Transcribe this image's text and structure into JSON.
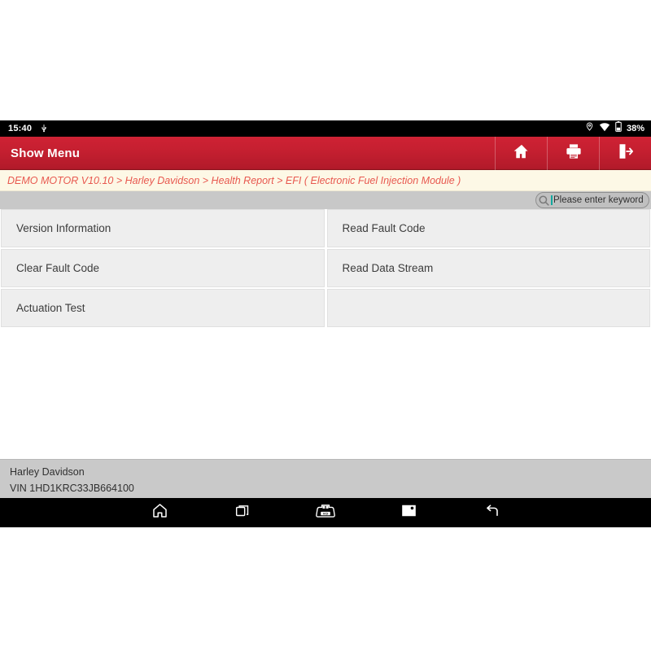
{
  "statusbar": {
    "time": "15:40",
    "usb_icon": "usb-debug-icon",
    "location_icon": "location-pin-icon",
    "wifi_icon": "wifi-icon",
    "battery_icon": "battery-icon",
    "battery_percent": "38%"
  },
  "appbar": {
    "title": "Show Menu",
    "buttons": [
      {
        "name": "home-button",
        "icon": "home-icon"
      },
      {
        "name": "print-button",
        "icon": "printer-icon"
      },
      {
        "name": "exit-button",
        "icon": "exit-icon"
      }
    ]
  },
  "breadcrumb": {
    "text": "DEMO MOTOR V10.10 > Harley Davidson > Health Report > EFI ( Electronic Fuel Injection Module )",
    "color": "#e8584f"
  },
  "search": {
    "icon": "search-icon",
    "placeholder": "Please enter keyword",
    "value": "",
    "caret_color": "#13a89e"
  },
  "menu": {
    "rows": [
      {
        "left": "Version Information",
        "right": "Read Fault Code"
      },
      {
        "left": "Clear Fault Code",
        "right": "Read Data Stream"
      },
      {
        "left": "Actuation Test",
        "right": ""
      }
    ]
  },
  "vehicle": {
    "make": "Harley Davidson",
    "vin": "VIN 1HD1KRC33JB664100"
  },
  "navbar": {
    "buttons": [
      {
        "name": "nav-home-button",
        "icon": "home-icon"
      },
      {
        "name": "nav-recents-button",
        "icon": "recents-icon"
      },
      {
        "name": "nav-vci-button",
        "icon": "vci-connector-icon"
      },
      {
        "name": "nav-screenshot-button",
        "icon": "image-icon"
      },
      {
        "name": "nav-back-button",
        "icon": "back-arrow-icon"
      }
    ]
  },
  "theme": {
    "accent_red": "#c41f30",
    "breadcrumb_bg": "#fdf8e6",
    "tile_bg": "#eeeeee",
    "footer_bg": "#c9c9c9"
  }
}
